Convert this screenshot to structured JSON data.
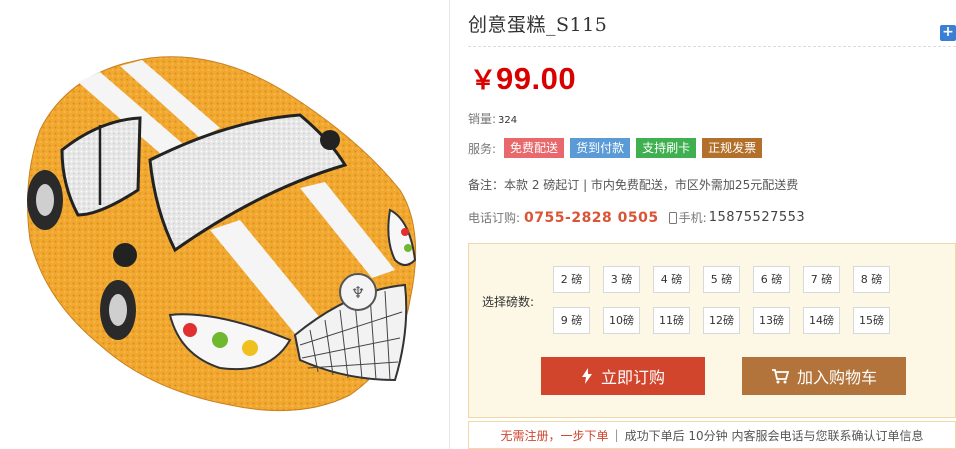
{
  "product": {
    "image_alt": "car-shaped cake",
    "title": "创意蛋糕_S115",
    "currency": "￥",
    "price": "99.00",
    "sales_label": "销量:",
    "sales_value": "324",
    "service_label": "服务:",
    "services": [
      "免费配送",
      "货到付款",
      "支持刷卡",
      "正规发票"
    ],
    "service_colors": [
      "#e8686c",
      "#5a9ad6",
      "#3fb050",
      "#b2702a"
    ],
    "note": "备注：本款 2 磅起订 | 市内免费配送，市区外需加25元配送费",
    "phone_label": "电话订购:",
    "phone": "0755-2828 0505",
    "mobile_label": "手机:",
    "mobile": "15875527553"
  },
  "weights": {
    "label": "选择磅数:",
    "options": [
      "2 磅",
      "3 磅",
      "4 磅",
      "5 磅",
      "6 磅",
      "7 磅",
      "8 磅",
      "9 磅",
      "10磅",
      "11磅",
      "12磅",
      "13磅",
      "14磅",
      "15磅"
    ]
  },
  "actions": {
    "buy_now": "立即订购",
    "add_cart": "加入购物车",
    "buy_icon": "lightning-icon",
    "cart_icon": "cart-icon",
    "add_icon": "plus-icon"
  },
  "footer": {
    "highlight": "无需注册，一步下单",
    "separator": "|",
    "text": "成功下单后 10分钟 内客服会电话与您联系确认订单信息"
  }
}
